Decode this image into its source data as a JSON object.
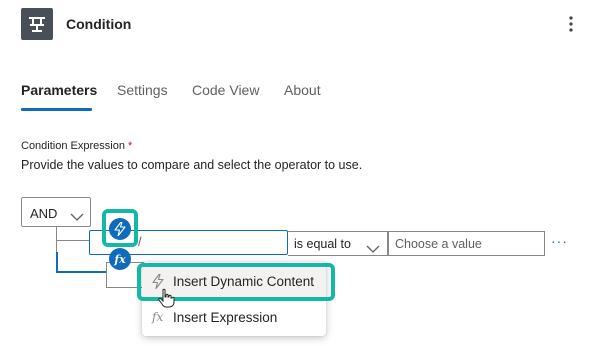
{
  "header": {
    "title": "Condition",
    "app_icon": "condition-icon",
    "more_icon": "more-vertical-icon"
  },
  "tabs": [
    {
      "label": "Parameters",
      "active": true
    },
    {
      "label": "Settings",
      "active": false
    },
    {
      "label": "Code View",
      "active": false
    },
    {
      "label": "About",
      "active": false
    }
  ],
  "field": {
    "label": "Condition Expression",
    "required_mark": "*",
    "description": "Provide the values to compare and select the operator to use."
  },
  "group": {
    "logic_operator": "AND"
  },
  "row": {
    "left_value": "/",
    "operator": "is equal to",
    "right_placeholder": "Choose a value",
    "more_label": "···"
  },
  "token_buttons": {
    "dynamic_icon": "lightning-icon",
    "expression_label": "fx"
  },
  "menu": {
    "items": [
      {
        "label": "Insert Dynamic Content",
        "icon": "lightning-icon",
        "highlighted": true
      },
      {
        "label": "Insert Expression",
        "icon": "fx-icon",
        "highlighted": false
      }
    ]
  },
  "colors": {
    "accent": "#0f6cbd",
    "highlight": "#14b8a6",
    "required": "#c50f1f",
    "icon_bg": "#484f58"
  }
}
